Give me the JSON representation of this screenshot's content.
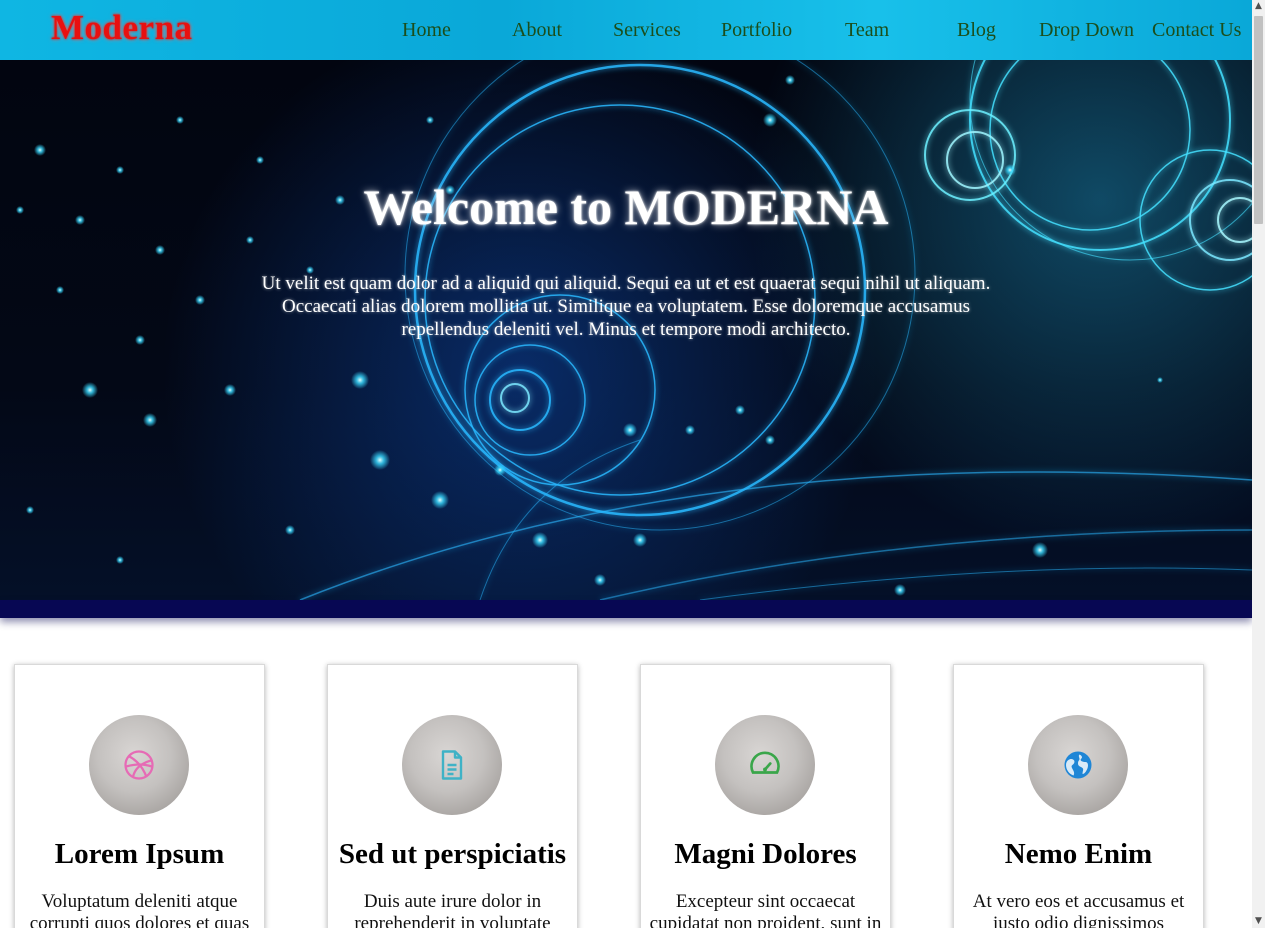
{
  "header": {
    "brand": "Moderna",
    "nav": [
      "Home",
      "About",
      "Services",
      "Portfolio",
      "Team",
      "Blog",
      "Drop Down",
      "Contact Us"
    ]
  },
  "hero": {
    "title": "Welcome to MODERNA",
    "text": "Ut velit est quam dolor ad a aliquid qui aliquid. Sequi ea ut et est quaerat sequi nihil ut aliquam. Occaecati alias dolorem mollitia ut. Similique ea voluptatem. Esse doloremque accusamus repellendus deleniti vel. Minus et tempore modi architecto."
  },
  "cards": [
    {
      "icon": "dribbble-icon",
      "color": "#e66bb5",
      "title": "Lorem Ipsum",
      "text": "Voluptatum deleniti atque corrupti quos dolores et quas"
    },
    {
      "icon": "document-icon",
      "color": "#3fb2c6",
      "title": "Sed ut perspiciatis",
      "text": "Duis aute irure dolor in reprehenderit in voluptate velit"
    },
    {
      "icon": "speedometer-icon",
      "color": "#3aa64a",
      "title": "Magni Dolores",
      "text": "Excepteur sint occaecat cupidatat non proident, sunt in"
    },
    {
      "icon": "globe-icon",
      "color": "#1f86d6",
      "title": "Nemo Enim",
      "text": "At vero eos et accusamus et iusto odio dignissimos"
    }
  ],
  "colors": {
    "brand": "#e81010",
    "nav_bg": "#0fb6e3",
    "nav_text": "#1b4e1b",
    "hero_bar": "#070753"
  }
}
